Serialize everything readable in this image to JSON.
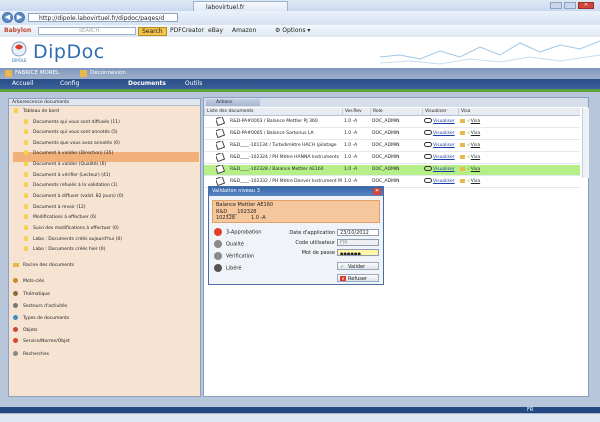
{
  "browser": {
    "url": "http://dipole.labovirtuel.fr/dipdoc/pages/d",
    "tab_label": "labovirtuel.fr",
    "toolbar": {
      "brand": "Babylon",
      "search_placeholder": "SEARCH",
      "search_button": "Search",
      "links": [
        "PDFCreator",
        "eBay",
        "Amazon"
      ],
      "options": "Options"
    }
  },
  "app": {
    "logo": "DipDoc",
    "user_name": "FABRICE MOREL",
    "logout": "Déconnexion",
    "menu": [
      "Accueil",
      "Config",
      "Documents",
      "Outils"
    ]
  },
  "left_panel": {
    "header": "Arborescence documents",
    "items": [
      {
        "label": "Tableau de bord",
        "icon": "bulb-icon"
      },
      {
        "label": "Documents qui vous sont diffusés (11)",
        "icon": "bulb-icon"
      },
      {
        "label": "Documents qui vous sont annotés (5)",
        "icon": "bulb-icon"
      },
      {
        "label": "Documents que vous avez annotés (0)",
        "icon": "bulb-icon"
      },
      {
        "label": "Document à valider (Direction) (35)",
        "icon": "bulb-icon"
      },
      {
        "label": "Document à valider (Qualité) (6)",
        "icon": "bulb-icon"
      },
      {
        "label": "Document à vérifier (Lecteur) (41)",
        "icon": "bulb-icon"
      },
      {
        "label": "Documents refusés à la validation (1)",
        "icon": "bulb-icon"
      },
      {
        "label": "Document à diffuser (valid. 82 jours) (0)",
        "icon": "bulb-icon"
      },
      {
        "label": "Document à revoir (12)",
        "icon": "bulb-icon"
      },
      {
        "label": "Modifications à effectuer (6)",
        "icon": "bulb-icon"
      },
      {
        "label": "Suivi des modifications à effectuer (0)",
        "icon": "bulb-icon"
      },
      {
        "label": "Labo : Documents créés aujourd'hui (0)",
        "icon": "bulb-icon"
      },
      {
        "label": "Labo : Documents créés hier (0)",
        "icon": "bulb-icon"
      },
      {
        "label": "Racine des documents",
        "icon": "folder-icon"
      },
      {
        "label": "Mots-clés",
        "icon": "key-icon"
      },
      {
        "label": "Thématique",
        "icon": "theme-icon"
      },
      {
        "label": "Secteurs d'activités",
        "icon": "sector-icon"
      },
      {
        "label": "Types de documents",
        "icon": "globe-icon"
      },
      {
        "label": "Objets",
        "icon": "object-icon"
      },
      {
        "label": "Service/Norme/Objet",
        "icon": "service-icon"
      },
      {
        "label": "Recherches",
        "icon": "search-icon"
      }
    ]
  },
  "right_panel": {
    "actions_label": "Actions",
    "columns": [
      "Liste des documents",
      "Ver.Rev",
      "Role",
      "Visualiser",
      "Visa"
    ],
    "rows": [
      {
        "doc": "R&D-PA#0003 / Balance Mettler PJ 360",
        "rev": "1.0 -A",
        "role": "DOC_ADMIN",
        "view": "Visualiser",
        "visa": "Visa",
        "highlight": false
      },
      {
        "doc": "R&D-PA#0005 / Balance Sartorius LA",
        "rev": "1.0 -A",
        "role": "DOC_ADMIN",
        "view": "Visualiser",
        "visa": "Visa",
        "highlight": false
      },
      {
        "doc": "R&D____-101134 / Turbidimètre HACH (pilotage",
        "rev": "1.0 -A",
        "role": "DOC_ADMIN",
        "view": "Visualiser",
        "visa": "Visa",
        "highlight": false
      },
      {
        "doc": "R&D____-102324 / PH Mètre HANNA Instruments",
        "rev": "1.0 -A",
        "role": "DOC_ADMIN",
        "view": "Visualiser",
        "visa": "Visa",
        "highlight": false
      },
      {
        "doc": "R&D____-102328 / Balance Mettler AE160",
        "rev": "1.0 -A",
        "role": "DOC_ADMIN",
        "view": "Visualiser",
        "visa": "Visa",
        "highlight": true
      },
      {
        "doc": "R&D____-102332 / PH Mètre Denver Instrument M",
        "rev": "1.0 -A",
        "role": "DOC_ADMIN",
        "view": "Visualiser",
        "visa": "Visa",
        "highlight": false
      }
    ]
  },
  "dialog": {
    "title": "Validation niveau 3",
    "doc_lines": [
      "Balance Mettler AE160",
      "R&D____102328",
      "102328          1.0 -A"
    ],
    "steps": [
      {
        "label": "3-Approbation",
        "color": "#e0402a"
      },
      {
        "label": "Qualité",
        "color": "#888888"
      },
      {
        "label": "Vérification",
        "color": "#888888"
      },
      {
        "label": "Libéré",
        "color": "#555555"
      }
    ],
    "fields": {
      "date_label": "Date d'application",
      "date_value": "23/10/2012",
      "user_label": "Code utilisateur",
      "user_value": "FM",
      "password_label": "Mot de passe",
      "password_value": "●●●●●●"
    },
    "validate_button": "Valider",
    "reject_button": "Refuser"
  },
  "status": {
    "zoom": "FR"
  }
}
